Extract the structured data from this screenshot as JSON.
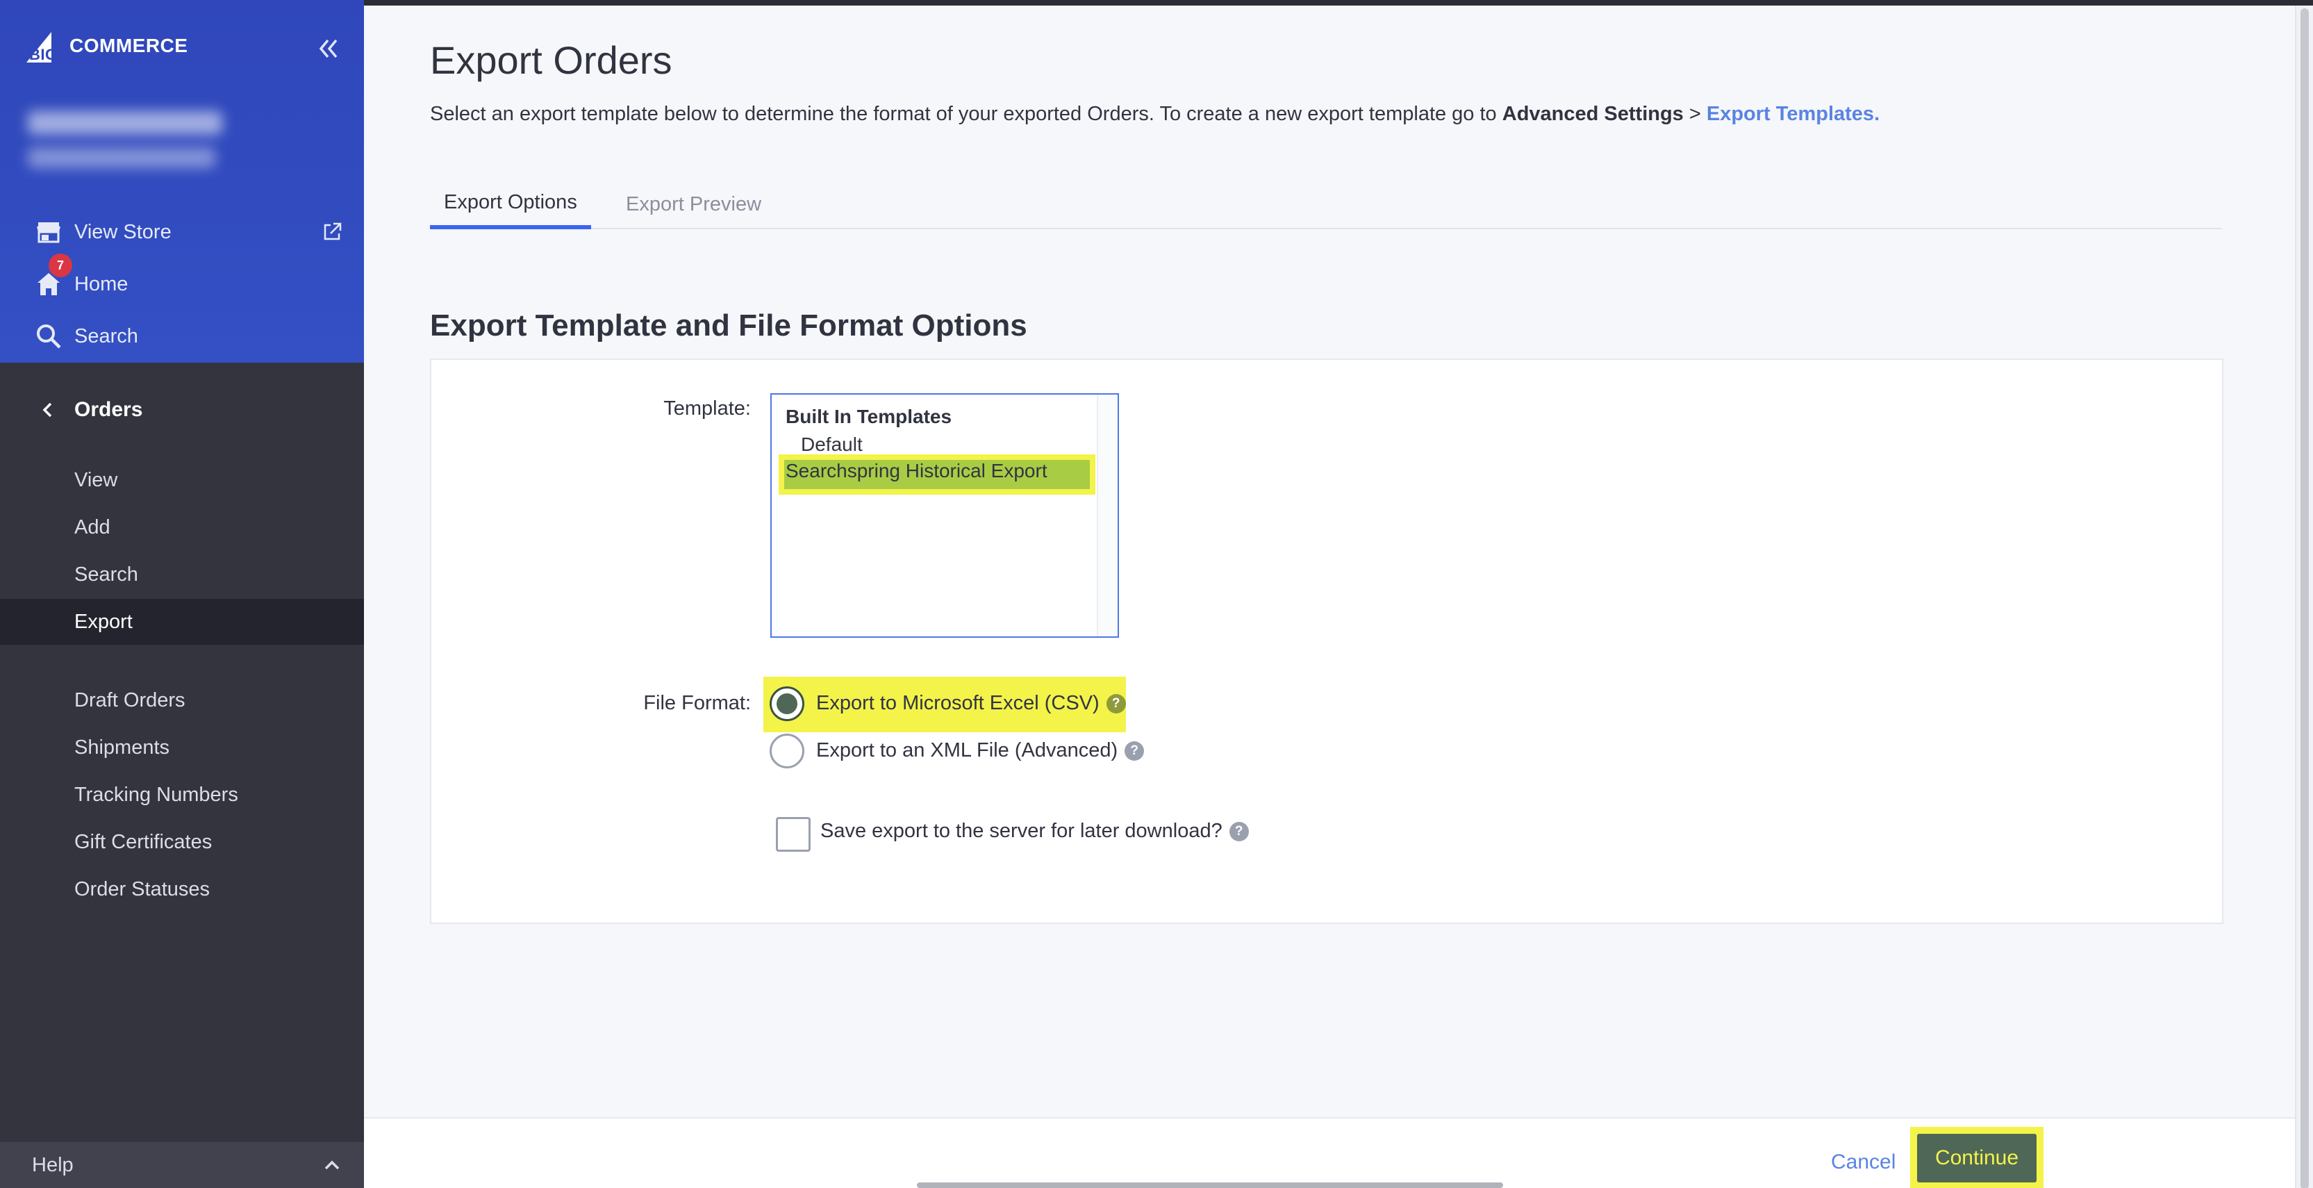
{
  "sidebar": {
    "logo_text": "COMMERCE",
    "logo_prefix": "BIG",
    "top_items": [
      {
        "label": "View Store",
        "icon": "store-icon"
      },
      {
        "label": "Home",
        "icon": "home-icon",
        "badge": "7"
      },
      {
        "label": "Search",
        "icon": "search-icon"
      }
    ],
    "section": {
      "label": "Orders"
    },
    "sub_items": [
      {
        "label": "View"
      },
      {
        "label": "Add"
      },
      {
        "label": "Search"
      },
      {
        "label": "Export"
      },
      {
        "label": "Draft Orders"
      },
      {
        "label": "Shipments"
      },
      {
        "label": "Tracking Numbers"
      },
      {
        "label": "Gift Certificates"
      },
      {
        "label": "Order Statuses"
      }
    ],
    "active_item": "Export",
    "help_label": "Help"
  },
  "page": {
    "title": "Export Orders",
    "desc_prefix": "Select an export template below to determine the format of your exported Orders. To create a new export template go to ",
    "desc_bold": "Advanced Settings",
    "desc_sep": " > ",
    "desc_link": "Export Templates.",
    "tabs": [
      {
        "label": "Export Options",
        "active": true
      },
      {
        "label": "Export Preview",
        "active": false
      }
    ],
    "section_title": "Export Template and File Format Options"
  },
  "form": {
    "template_label": "Template:",
    "template_group": "Built In Templates",
    "template_options": [
      "Default",
      "Searchspring Historical Export"
    ],
    "template_selected": "Searchspring Historical Export",
    "file_format_label": "File Format:",
    "format_options": [
      {
        "label": "Export to Microsoft Excel (CSV)",
        "checked": true
      },
      {
        "label": "Export to an XML File (Advanced)",
        "checked": false
      }
    ],
    "save_label": "Save export to the server for later download?",
    "save_checked": false
  },
  "footer": {
    "cancel_label": "Cancel",
    "continue_label": "Continue"
  },
  "colors": {
    "sidebar_top": "#2f47ba",
    "sidebar_bg": "#34343f",
    "accent": "#3c64f4",
    "link": "#5b83e3",
    "highlight": "#f3f34a",
    "primary_button": "#4f6756"
  }
}
